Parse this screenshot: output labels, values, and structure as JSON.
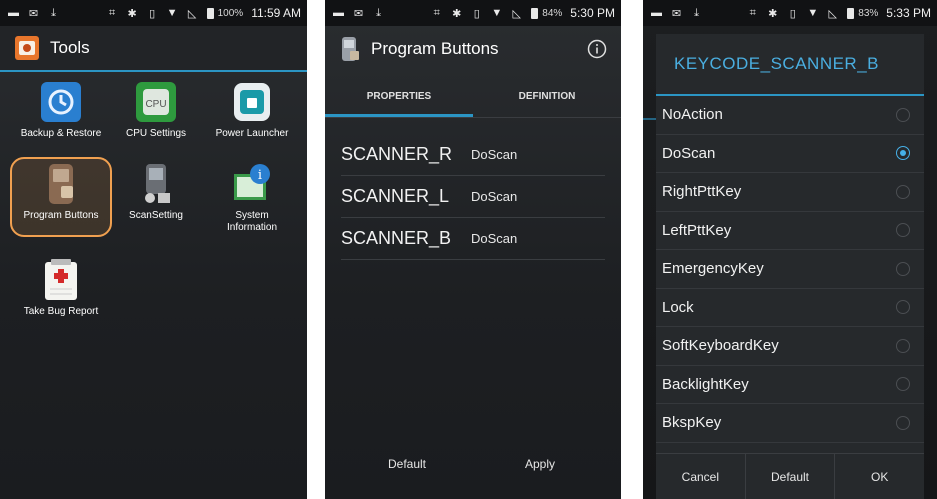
{
  "screen1": {
    "status": {
      "battery": "100%",
      "time": "11:59 AM"
    },
    "title": "Tools",
    "apps": [
      {
        "label": "Backup & Restore",
        "icon": "backup-restore-icon"
      },
      {
        "label": "CPU Settings",
        "icon": "cpu-icon"
      },
      {
        "label": "Power Launcher",
        "icon": "power-launcher-icon"
      },
      {
        "label": "Program Buttons",
        "icon": "program-buttons-icon"
      },
      {
        "label": "ScanSetting",
        "icon": "scan-setting-icon"
      },
      {
        "label": "System\nInformation",
        "icon": "system-info-icon"
      },
      {
        "label": "Take Bug Report",
        "icon": "bug-report-icon"
      }
    ],
    "cpu_icon_text": "CPU"
  },
  "screen2": {
    "status": {
      "battery": "84%",
      "time": "5:30 PM"
    },
    "title": "Program Buttons",
    "tabs": [
      "PROPERTIES",
      "DEFINITION"
    ],
    "rows": [
      {
        "key": "SCANNER_R",
        "value": "DoScan"
      },
      {
        "key": "SCANNER_L",
        "value": "DoScan"
      },
      {
        "key": "SCANNER_B",
        "value": "DoScan"
      }
    ],
    "footer": {
      "default": "Default",
      "apply": "Apply"
    }
  },
  "screen3": {
    "status": {
      "battery": "83%",
      "time": "5:33 PM"
    },
    "dialog_title": "KEYCODE_SCANNER_B",
    "options": [
      "NoAction",
      "DoScan",
      "RightPttKey",
      "LeftPttKey",
      "EmergencyKey",
      "Lock",
      "SoftKeyboardKey",
      "BacklightKey",
      "BkspKey"
    ],
    "selected": "DoScan",
    "buttons": {
      "cancel": "Cancel",
      "default": "Default",
      "ok": "OK"
    }
  },
  "colors": {
    "accent": "#2b95c4",
    "highlight": "#f0a050",
    "background": "#1f2124"
  }
}
